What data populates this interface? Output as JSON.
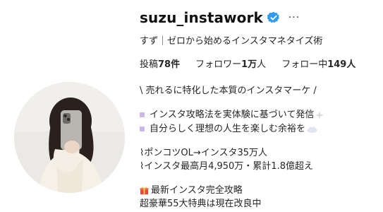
{
  "profile": {
    "username": "suzu_instawork",
    "more_label": "···",
    "name_line": "すず｜ゼロから始めるインスタマネタイズ術",
    "stats": {
      "posts_label": "投稿",
      "posts_value": "78件",
      "followers_label": "フォロワー",
      "followers_value": "1万",
      "followers_suffix": "人",
      "following_label": "フォロー中",
      "following_value": "149人"
    },
    "bio": {
      "line1": "\\ 売れるに特化した本質のインスタマーケ /",
      "line2": "インスタ攻略法を実体験に基づいて発信",
      "line3": "自分らしく理想の人生を楽しむ余裕を",
      "line4": "⌇ポンコツOL→インスタ35万人",
      "line5": "⌇インスタ最高月4,950万・累計1.8億超え",
      "line6": "最新インスタ完全攻略",
      "line7": "超豪華55大特典は現在改良中"
    }
  },
  "colors": {
    "verified": "#2f9cf4",
    "text": "#262626",
    "bullet": "#c9b7e8"
  },
  "icons": {
    "verified": "verified-badge-icon",
    "bullet": "purple-square-icon",
    "gift": "gift-icon",
    "sparkle": "sparkle-icon",
    "cloud": "cloud-icon"
  }
}
